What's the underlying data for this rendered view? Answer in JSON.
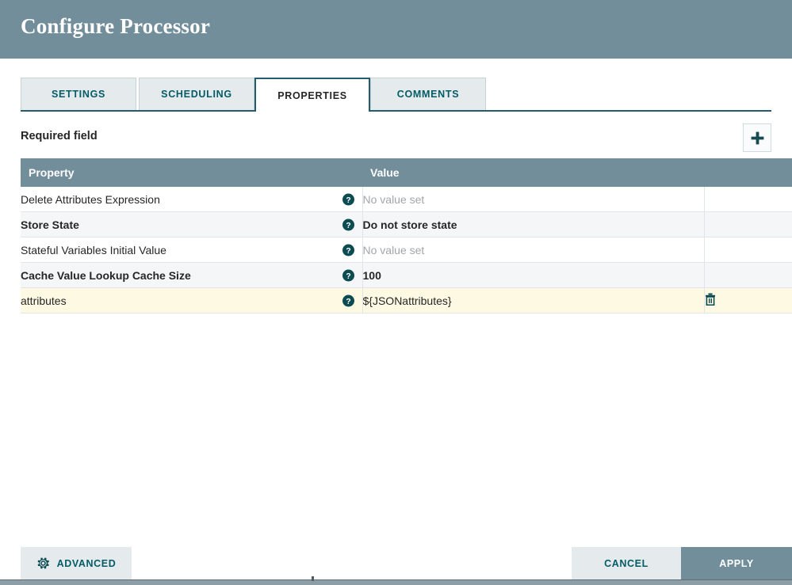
{
  "dialog": {
    "title": "Configure Processor"
  },
  "tabs": [
    {
      "label": "SETTINGS",
      "active": false
    },
    {
      "label": "SCHEDULING",
      "active": false
    },
    {
      "label": "PROPERTIES",
      "active": true
    },
    {
      "label": "COMMENTS",
      "active": false
    }
  ],
  "toolbar": {
    "required_field_label": "Required field",
    "add_property_icon": "plus-icon"
  },
  "table": {
    "columns": [
      "Property",
      "Value",
      ""
    ],
    "rows": [
      {
        "property": "Delete Attributes Expression",
        "property_bold": false,
        "value": "No value set",
        "value_unset": true,
        "value_bold": false,
        "help_icon": "help-icon",
        "deletable": false,
        "shade": "odd"
      },
      {
        "property": "Store State",
        "property_bold": true,
        "value": "Do not store state",
        "value_unset": false,
        "value_bold": true,
        "help_icon": "help-icon",
        "deletable": false,
        "shade": "even"
      },
      {
        "property": "Stateful Variables Initial Value",
        "property_bold": false,
        "value": "No value set",
        "value_unset": true,
        "value_bold": false,
        "help_icon": "help-icon",
        "deletable": false,
        "shade": "odd"
      },
      {
        "property": "Cache Value Lookup Cache Size",
        "property_bold": true,
        "value": "100",
        "value_unset": false,
        "value_bold": true,
        "help_icon": "help-icon",
        "deletable": false,
        "shade": "even"
      },
      {
        "property": "attributes",
        "property_bold": false,
        "value": "${JSONattributes}",
        "value_unset": false,
        "value_bold": false,
        "help_icon": "help-icon",
        "deletable": true,
        "delete_icon": "trash-icon",
        "shade": "user"
      }
    ]
  },
  "footer": {
    "advanced_label": "ADVANCED",
    "advanced_icon": "gear-icon",
    "cancel_label": "CANCEL",
    "apply_label": "APPLY"
  },
  "colors": {
    "header_bg": "#728e9b",
    "accent_teal": "#035b66",
    "active_tab_border": "#255c6b",
    "tab_bg": "#e5ebed",
    "user_row_bg": "#fdf9e3",
    "row_alt_bg": "#f4f6f7",
    "unset_text": "#a0a8ac"
  }
}
